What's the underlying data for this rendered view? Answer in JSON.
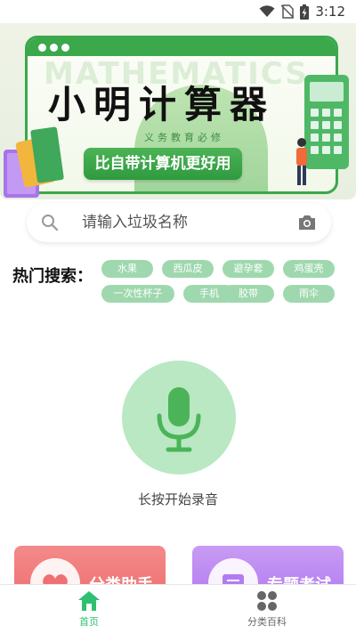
{
  "status_bar": {
    "time": "3:12",
    "icons": [
      "wifi-icon",
      "no-sim-icon",
      "battery-charging-icon"
    ]
  },
  "banner": {
    "background_text": "MATHEMATICS",
    "title": "小明计算器",
    "subtitle": "义务教育必修",
    "button_label": "比自带计算机更好用"
  },
  "search": {
    "placeholder": "请输入垃圾名称",
    "value": "",
    "left_icon": "search-icon",
    "right_icon": "camera-icon"
  },
  "hot_search": {
    "label": "热门搜索：",
    "tags": [
      "水果",
      "西瓜皮",
      "避孕套",
      "鸡蛋壳",
      "一次性杯子",
      "手机",
      "胶带",
      "雨伞"
    ]
  },
  "voice": {
    "icon": "microphone-icon",
    "label": "长按开始录音"
  },
  "cards": [
    {
      "label": "分类助手",
      "icon": "heart-icon",
      "color": "#ef7070"
    },
    {
      "label": "专题考试",
      "icon": "list-icon",
      "color": "#b37bf0"
    }
  ],
  "bottom_nav": {
    "items": [
      {
        "label": "首页",
        "icon": "home-icon",
        "active": true
      },
      {
        "label": "分类百科",
        "icon": "grid-icon",
        "active": false
      }
    ],
    "active_color": "#2fbf71"
  }
}
